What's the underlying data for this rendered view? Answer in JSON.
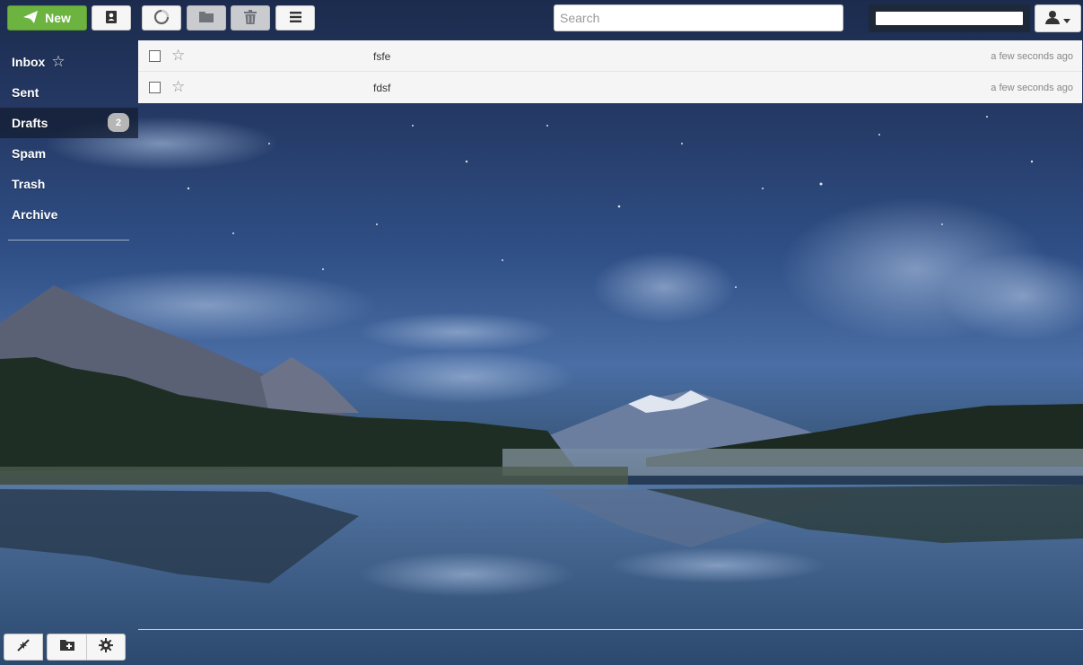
{
  "toolbar": {
    "new_label": "New",
    "search_placeholder": "Search",
    "search_value": ""
  },
  "sidebar": {
    "folders": [
      {
        "label": "Inbox"
      },
      {
        "label": "Sent"
      },
      {
        "label": "Drafts",
        "badge": "2"
      },
      {
        "label": "Spam"
      },
      {
        "label": "Trash"
      },
      {
        "label": "Archive"
      }
    ]
  },
  "messages": [
    {
      "subject": "fsfe",
      "time": "a few seconds ago"
    },
    {
      "subject": "fdsf",
      "time": "a few seconds ago"
    }
  ],
  "icons": {
    "new": "paper-plane-icon",
    "contacts": "address-book-icon",
    "refresh": "refresh-spinner-icon",
    "move": "folder-icon",
    "delete": "trash-icon",
    "menu": "hamburger-menu-icon",
    "user": "user-icon",
    "fullscreen": "collapse-arrows-icon",
    "new_folder": "folder-add-icon",
    "settings": "gear-icon"
  },
  "colors": {
    "new_button": "#6cb33f",
    "active_folder": "#141e32",
    "badge": "#b6b6b6"
  }
}
